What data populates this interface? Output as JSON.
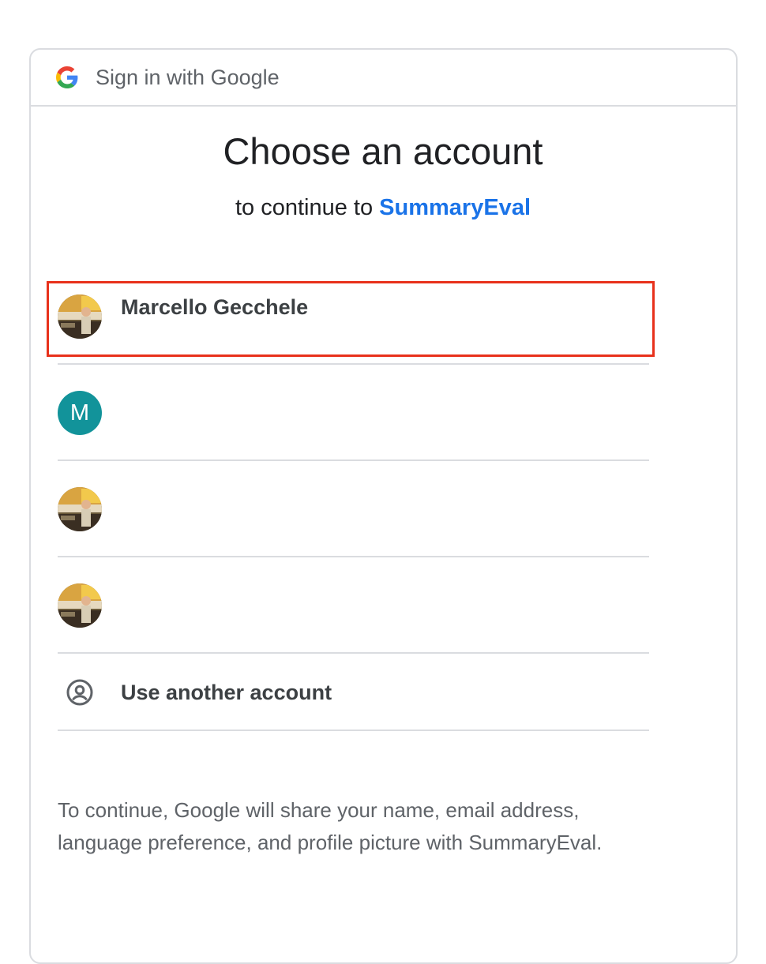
{
  "header": {
    "logo_icon": "google-g-icon",
    "title": "Sign in with Google"
  },
  "main": {
    "headline": "Choose an account",
    "subhead_prefix": "to continue to ",
    "app_name": "SummaryEval",
    "app_color": "#1a73e8"
  },
  "accounts": [
    {
      "name": "Marcello Gecchele",
      "avatar": "photo-avatar",
      "highlighted": true
    },
    {
      "name": "",
      "avatar": "letter-avatar",
      "letter": "M",
      "avatar_color": "#12939a"
    },
    {
      "name": "",
      "avatar": "photo-avatar"
    },
    {
      "name": "",
      "avatar": "photo-avatar"
    }
  ],
  "other_account": {
    "icon": "account-circle-icon",
    "label": "Use another account"
  },
  "disclaimer": "To continue, Google will share your name, email address, language preference, and profile picture with SummaryEval.",
  "colors": {
    "highlight_border": "#e8311b",
    "divider": "#dadce0"
  }
}
